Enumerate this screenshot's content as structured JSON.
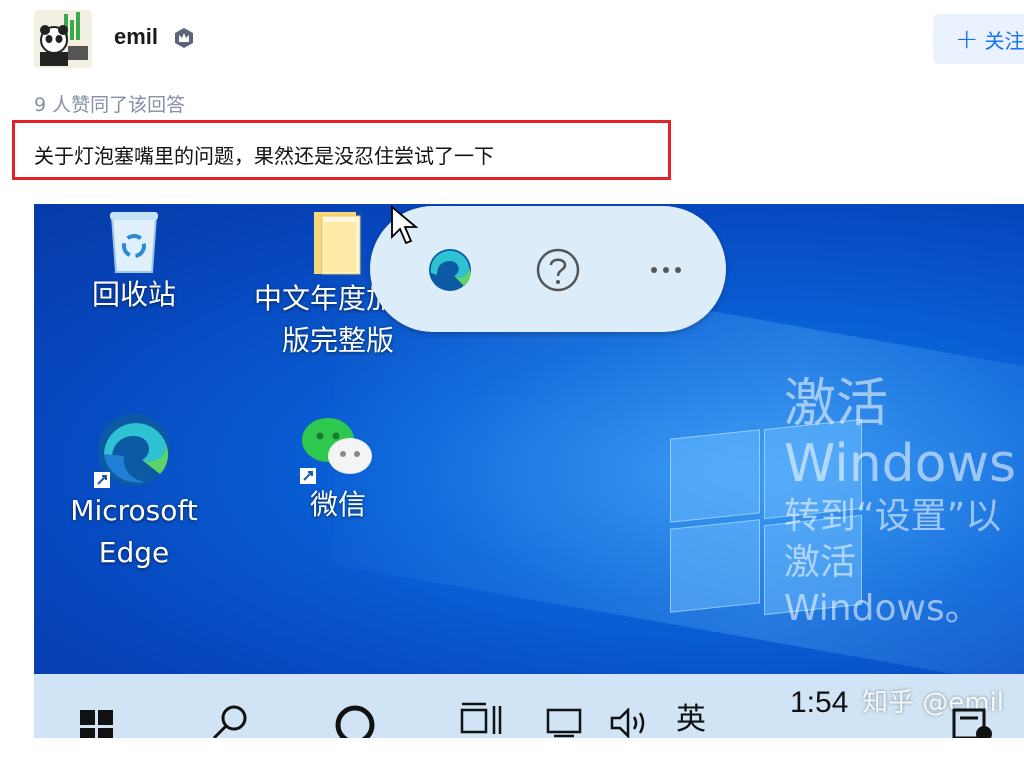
{
  "author": {
    "name": "emil",
    "badge_icon": "crown-badge-icon",
    "follow_label": "关注"
  },
  "likes_text": "9 人赞同了该回答",
  "answer_text": "关于灯泡塞嘴里的问题，果然还是没忍住尝试了一下",
  "screenshot": {
    "desktop_icons": [
      {
        "label": "回收站",
        "icon": "recycle-bin-icon"
      },
      {
        "label": "中文年度加强\n版完整版",
        "icon": "folder-icon"
      },
      {
        "label": "Microsoft\nEdge",
        "icon": "edge-icon"
      },
      {
        "label": "微信",
        "icon": "wechat-icon"
      }
    ],
    "activation_title_1": "激活",
    "activation_title_2": "Windows",
    "activation_sub_1": "转到“设置”以",
    "activation_sub_2": "激活",
    "activation_sub_3": "Windows。",
    "clock": "1:54",
    "watermark": "知乎 @emil",
    "ime": "英"
  },
  "colors": {
    "follow_accent": "#1772f6",
    "highlight_border": "#e3212b",
    "meta_gray": "#8590a6"
  }
}
